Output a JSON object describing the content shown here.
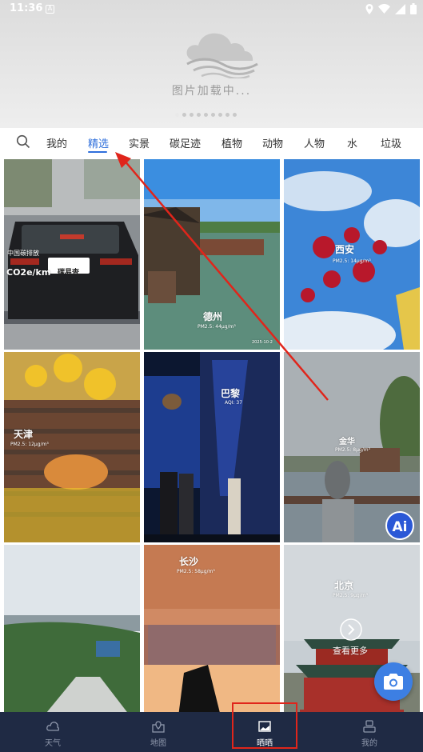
{
  "status_bar": {
    "time": "11:36",
    "icons": [
      "notification-a-icon",
      "location-icon",
      "wifi-icon",
      "signal-icon",
      "battery-icon"
    ]
  },
  "banner": {
    "loading_text": "图片加载中...",
    "page_dots": 9,
    "active_dot": 0
  },
  "tabs": {
    "items": [
      "我的",
      "精选",
      "实景",
      "碳足迹",
      "植物",
      "动物",
      "人物",
      "水",
      "垃圾"
    ],
    "active": "精选"
  },
  "photos": [
    {
      "place": "",
      "pm": "",
      "overlay_text": [
        "中国碳排放",
        "CO2e/km",
        "碳易查"
      ]
    },
    {
      "place": "德州",
      "pm": "PM2.5: 44μg/m³",
      "date": "2025-10-2"
    },
    {
      "place": "西安",
      "pm": "PM2.5: 14μg/m³"
    },
    {
      "place": "天津",
      "pm": "PM2.5: 12μg/m³"
    },
    {
      "place": "巴黎",
      "pm": "AQI: 37"
    },
    {
      "place": "金华",
      "pm": "PM2.5: 8μg/m³",
      "ai_badge": "Ai"
    },
    {
      "place": "",
      "pm": ""
    },
    {
      "place": "长沙",
      "pm": "PM2.5: 58μg/m³"
    },
    {
      "place": "北京",
      "pm": "PM2.5: 9μg/m³",
      "more_label": "查看更多"
    }
  ],
  "bottom_nav": {
    "items": [
      {
        "label": "天气",
        "icon": "weather-icon"
      },
      {
        "label": "地图",
        "icon": "map-icon"
      },
      {
        "label": "晒晒",
        "icon": "photo-icon"
      },
      {
        "label": "我的",
        "icon": "profile-icon"
      }
    ],
    "active": "晒晒"
  },
  "colors": {
    "accent": "#2f6fdb",
    "nav_bg": "#1f2a44",
    "annotation": "#e0251b",
    "camera": "#3d7fe3"
  }
}
